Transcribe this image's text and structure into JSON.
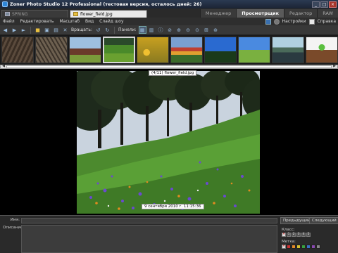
{
  "window": {
    "title": "Zoner Photo Studio 12 Professional (тестовая версия, осталось дней: 26)",
    "buttons": [
      "_",
      "□",
      "×"
    ]
  },
  "tabs": {
    "documents": [
      {
        "label": "SPRING",
        "active": false
      },
      {
        "label": "flower_field.jpg",
        "active": true
      }
    ],
    "modes": [
      {
        "label": "Менеджер",
        "active": false
      },
      {
        "label": "Просмотрщик",
        "active": true
      },
      {
        "label": "Редактор",
        "active": false
      },
      {
        "label": "RAW",
        "active": false
      }
    ]
  },
  "menu": {
    "items": [
      "Файл",
      "Редактировать",
      "Масштаб",
      "Вид",
      "Слайд шоу"
    ],
    "settings": "Настройки",
    "help": "Справка"
  },
  "toolbar": {
    "rotate_label": "Вращать:",
    "panels_label": "Панели:"
  },
  "filmstrip": {
    "thumbnails": [
      "tree-bark",
      "rock-texture",
      "barn",
      "flower-field",
      "sunflowers",
      "tulip-field",
      "tree-on-hill",
      "meadow",
      "lake",
      "seedling-hands"
    ],
    "selected_index": 3
  },
  "viewer": {
    "caption": "(4/11) flower_field.jpg",
    "date": "9 сентября 2010 г. 11:15:36"
  },
  "info_panel": {
    "name_label": "Имя:",
    "description_label": "Описание:",
    "prev_button": "Предыдущий",
    "next_button": "Следующий",
    "class_label": "Класс:",
    "rating_digits": [
      "1",
      "2",
      "3",
      "4",
      "5"
    ],
    "label_label": "Метка:",
    "label_colors": [
      "#cc3333",
      "#e08a2a",
      "#d8c030",
      "#3aa040",
      "#3a70c8",
      "#8a4ab0",
      "#888888"
    ]
  }
}
